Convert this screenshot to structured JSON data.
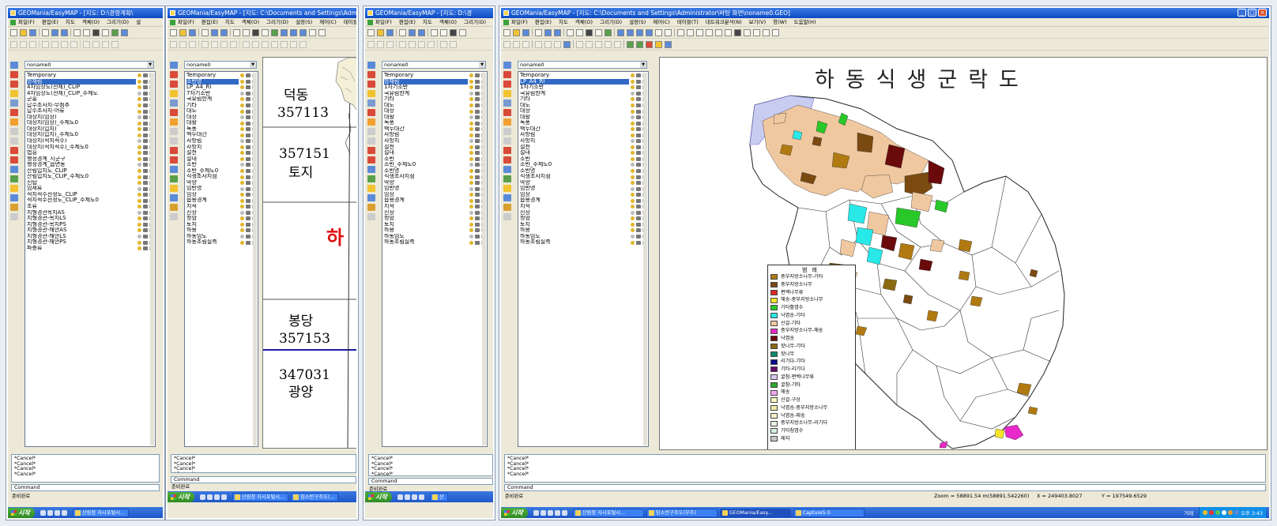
{
  "w1": {
    "title": "GEOMania/EasyMAP - [지도: D:\\경영계획\\",
    "menu": [
      "파일(F)",
      "편집(E)",
      "지도",
      "객체(O)",
      "그리기(D)",
      "설"
    ],
    "dropdown": "noname0",
    "layers": [
      "Temporary",
      "방재림",
      "4차임상도(전체)_CLIP",
      "4차임상도(전체)_CLIP_주제도",
      "군홍",
      "답수조사지-무첨추",
      "답수조사지-어류",
      "대상지(임상)",
      "대상지(임상)_주제도0",
      "대상지(입지)",
      "대상지(입지)_주제도0",
      "대상지(적지적수)",
      "대상지(적지적수)_주제도0",
      "법흥",
      "행정경계_시군구",
      "행정경계_읍면동",
      "산림입지도_CLIP",
      "산림입지도_CLIP_주제도0",
      "신탑",
      "임세류",
      "적지적수선정도_CLIP",
      "적지적수선정도_CLIP_주제도0",
      "조류",
      "지형경관목지AS",
      "지형경관-목지LS",
      "지형경관-목지PS",
      "지형경관-해안AS",
      "지형경관-해안LS",
      "지형경관-해안PS",
      "파충류"
    ],
    "log": "*Cancel*\n*Cancel*\n*Cancel*\n*Cancel*",
    "command": "Command",
    "status": "준비완료",
    "start": "시작",
    "tasks": [
      "산림청 자시포털시..."
    ]
  },
  "w2": {
    "title": "GEOMania/EasyMAP - [지도: C:\\Documents and Settings\\Adm",
    "menu": [
      "파일(F)",
      "편집(E)",
      "지도",
      "객체(O)",
      "그리기(D)",
      "설정(S)",
      "제어(C)",
      "테이블(T)"
    ],
    "dropdown": "noname0",
    "layers": [
      "Temporary",
      "소반명",
      "LP_A4_RI",
      "7차기소반",
      "국유림한계",
      "기타",
      "대도",
      "대상",
      "대활",
      "녹풍",
      "백두대간",
      "사방림",
      "사방지",
      "설천",
      "설내",
      "소반",
      "소반_주제도0",
      "식생조사지점",
      "악양",
      "임반명",
      "임상",
      "읍용경계",
      "지적",
      "진상",
      "청암",
      "토지",
      "하용",
      "하동임도",
      "하동조림실측"
    ],
    "labels": [
      "덕동",
      "357113",
      "357151",
      "토지",
      "봉당",
      "357153",
      "347031",
      "광양"
    ],
    "red": "하",
    "log": "*Cancel*\n*Cancel*\n*Cancel*\n*Cancel*",
    "command": "Command",
    "status": "준비완료",
    "start": "시작",
    "tasks": [
      "산림청 자시포털시...",
      "임소반구조도(..."
    ]
  },
  "w3": {
    "title": "GEOMania/EasyMAP - [지도: D:\\경",
    "menu": [
      "파일(F)",
      "편집(E)",
      "지도",
      "객체(O)",
      "그리기(D)",
      "설정"
    ],
    "dropdown": "noname0",
    "layers": [
      "Temporary",
      "방재림",
      "1차기소반",
      "국유림한계",
      "기타",
      "대도",
      "대상",
      "대활",
      "녹풍",
      "백두대간",
      "사방림",
      "사방지",
      "설천",
      "설내",
      "소반",
      "소반_주제도0",
      "소반명",
      "식생조사지점",
      "악양",
      "임반명",
      "임상",
      "읍용경계",
      "지적",
      "진상",
      "청암",
      "토지",
      "하용",
      "하동임도",
      "하동조림실측"
    ],
    "layers2": [
      "Temporary",
      "방재림",
      "4차임상도(전체)_CLIP",
      "4차임상도(전체)_CLIP_주제도",
      "군홍",
      "답수조사지-무첨추",
      "답수조사지-어류",
      "대상지(임상)",
      "대상지(임상)_주제도0",
      "대상지(입지)",
      "대상지(입지)_주제도0",
      "대상지(적지적수)",
      "대상지(적지적수)_주제도0",
      "법흥",
      "행정경계_시군구",
      "행정경계_읍면동",
      "산림입지도_CLIP",
      "산림입지도_CLIP_주제도0",
      "신탑",
      "임세류",
      "적지적수선정도_CLIP",
      "적지적수선정도_CLIP_주제도0",
      "조류",
      "지형경관목지AS",
      "지형경관-목지LS",
      "지형경관-목지PS",
      "지형경관-해안AS",
      "지형경관-해안LS",
      "지형경관-해안PS",
      "파충류"
    ],
    "log": "*Cancel*\n*Cancel*\n*Cancel*\n*Cancel*",
    "command": "Command",
    "status": "준비완료",
    "start": "시작",
    "tasks": [
      "산"
    ]
  },
  "w4": {
    "title": "GEOMania/EasyMAP - [지도: C:\\Documents and Settings\\Administrator\\바탕 화면\\noname0.GEO]",
    "menu": [
      "파일(F)",
      "편집(E)",
      "지도",
      "객체(O)",
      "그리기(D)",
      "설정(S)",
      "제어(C)",
      "테이블(T)",
      "네트워크분석(N)",
      "보기(V)",
      "창(W)",
      "도움말(H)"
    ],
    "dropdown": "noname0",
    "layers": [
      "Temporary",
      "LP_A4_RI",
      "1차기소반",
      "국유림한계",
      "기타",
      "대도",
      "대상",
      "대활",
      "녹풍",
      "백두대간",
      "사방림",
      "사방지",
      "설천",
      "설내",
      "소반",
      "소반_주제도0",
      "소반명",
      "식생조사지점",
      "악양",
      "임반명",
      "임상",
      "읍용경계",
      "지적",
      "진상",
      "청암",
      "토지",
      "하용",
      "하동임도",
      "하동조림실측"
    ],
    "map_title": "하동식생군락도",
    "legend_title": "범례",
    "legend": [
      {
        "label": "중부지방소나무-기타",
        "color": "#b07a10"
      },
      {
        "label": "중부지방소나무",
        "color": "#7a4a10"
      },
      {
        "label": "편백나무류",
        "color": "#e02828"
      },
      {
        "label": "해송-중부지방소나무",
        "color": "#f5e52a"
      },
      {
        "label": "기타활엽수",
        "color": "#28c828"
      },
      {
        "label": "낙엽송-기타",
        "color": "#28e8e8"
      },
      {
        "label": "신갈-기타",
        "color": "#f0c8a0"
      },
      {
        "label": "중부지방소나무-해송",
        "color": "#e828c8"
      },
      {
        "label": "낙엽송",
        "color": "#6a0a0a"
      },
      {
        "label": "잣나무-기타",
        "color": "#8a6a10"
      },
      {
        "label": "잣나무",
        "color": "#0a8a6a"
      },
      {
        "label": "리기다-기타",
        "color": "#0a0a8a"
      },
      {
        "label": "기타-리기다",
        "color": "#6a0a6a"
      },
      {
        "label": "굴참-편백나무류",
        "color": "#d8c8f0"
      },
      {
        "label": "굴참-기타",
        "color": "#2aa82a"
      },
      {
        "label": "해송",
        "color": "#f0a8f0"
      },
      {
        "label": "신갈-구상",
        "color": "#f8f8c0"
      },
      {
        "label": "낙엽송-중부지방소나무",
        "color": "#f0e8a8"
      },
      {
        "label": "낙엽송-해송",
        "color": "#f8f0c8"
      },
      {
        "label": "중부지방소나무-리기다",
        "color": "#e8f0e0"
      },
      {
        "label": "기타침엽수",
        "color": "#d0f0e0"
      },
      {
        "label": "제지",
        "color": "#c8c8c8"
      }
    ],
    "log": "*Cancel*\n*Cancel*\n*Cancel*\n*Cancel*",
    "command": "Command",
    "status": "준비완료",
    "zoom": "Zoom = 58891.54 m(58891.542260)",
    "xcoord": "X = 249403.8027",
    "ycoord": "Y = 197549.6529",
    "start": "시작",
    "tasks": [
      "산림청 자시포털시...",
      "임소반구조도(무주)",
      "GEOMania/Easy...",
      "Capture5.0"
    ],
    "tray_label": "거래",
    "clock": "오후 3:43"
  }
}
